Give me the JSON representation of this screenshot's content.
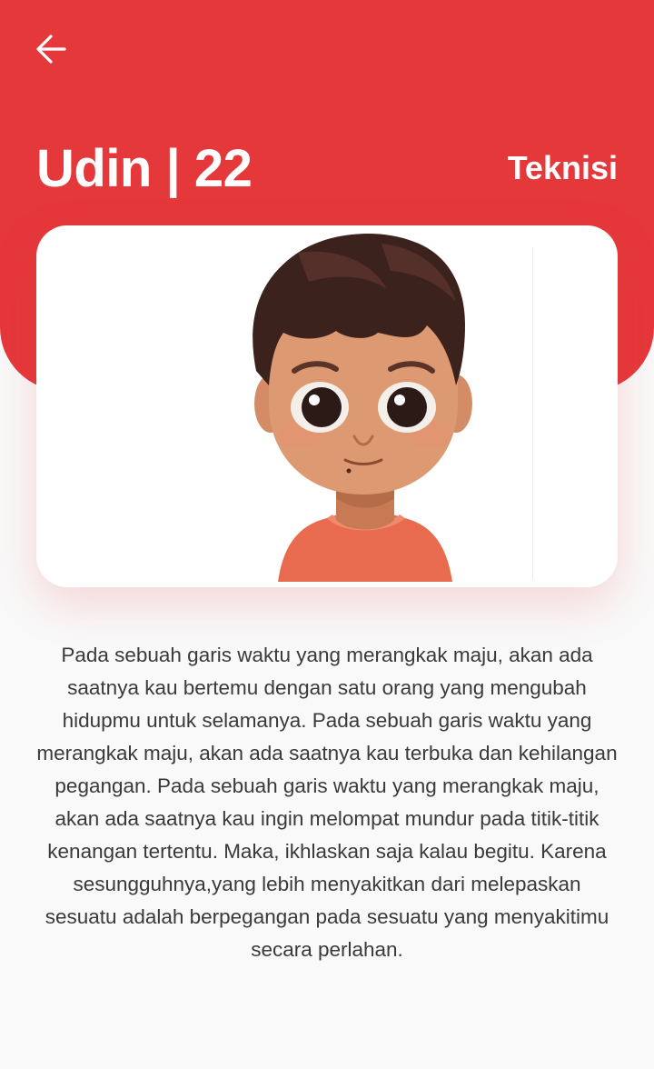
{
  "profile": {
    "name_age": "Udin | 22",
    "role": "Teknisi",
    "bio": "Pada sebuah garis waktu yang merangkak maju, akan ada saatnya kau bertemu dengan satu orang yang mengubah hidupmu untuk selamanya. Pada sebuah garis waktu yang merangkak maju, akan ada saatnya kau terbuka dan kehilangan pegangan.   Pada sebuah garis waktu yang merangkak maju, akan ada saatnya kau ingin melompat mundur pada titik-titik kenangan tertentu. Maka, ikhlaskan saja kalau begitu. Karena sesungguhnya,yang lebih menyakitkan dari melepaskan sesuatu adalah berpegangan pada sesuatu yang menyakitimu secara perlahan."
  },
  "icons": {
    "back": "arrow-left-icon",
    "avatar": "cartoon-boy-avatar"
  },
  "colors": {
    "primary": "#e5383b",
    "header_text": "#ffffff",
    "body_text": "#3a3a3a",
    "background": "#f9f9f9",
    "card": "#ffffff"
  }
}
